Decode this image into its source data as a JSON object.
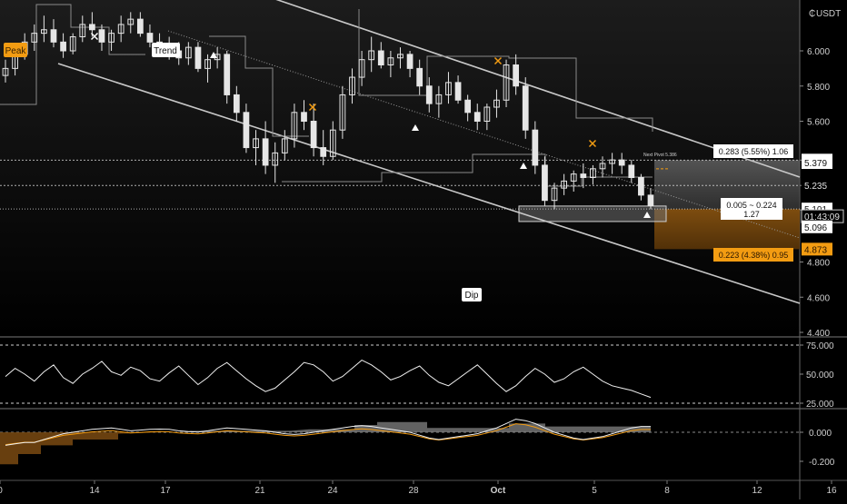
{
  "currency_label": "USDT",
  "main_axis": {
    "ticks": [
      "6.000",
      "5.800",
      "5.600",
      "5.379",
      "5.235",
      "5.096",
      "4.800",
      "4.600",
      "4.400"
    ],
    "tick_values": [
      6.0,
      5.8,
      5.6,
      5.379,
      5.235,
      5.096,
      4.8,
      4.6,
      4.4
    ]
  },
  "price_tags": [
    {
      "text": "5.379",
      "value": 5.379,
      "style": "light"
    },
    {
      "text": "5.379",
      "value": 5.365,
      "style": "light"
    },
    {
      "text": "5.235",
      "value": 5.235,
      "style": "dark"
    },
    {
      "text": "5.101",
      "value": 5.101,
      "style": "light"
    },
    {
      "text": "01:43:09",
      "value": 5.06,
      "style": "outline"
    },
    {
      "text": "5.096",
      "value": 5.0,
      "style": "light"
    },
    {
      "text": "4.873",
      "value": 4.873,
      "style": "orange"
    }
  ],
  "date_axis": {
    "labels": [
      "0",
      "14",
      "17",
      "21",
      "24",
      "28",
      "Oct",
      "5",
      "8",
      "12",
      "16"
    ],
    "label_day_index": [
      10,
      14,
      17,
      21,
      24,
      28,
      31,
      35,
      38,
      42,
      46
    ]
  },
  "annotations": {
    "peak": "Peak",
    "trend": "Trend",
    "dip": "Dip",
    "next_pivot": "Next Pivot 5.386",
    "target_up": "0.283 (5.55%) 1.06",
    "mid_line1": "0.005 ~ 0.224",
    "mid_line2": "1.27",
    "target_down": "0.223 (4.38%) 0.95"
  },
  "rsi_axis": {
    "ticks": [
      "75.000",
      "50.000",
      "25.000"
    ],
    "tick_values": [
      75,
      50,
      25
    ]
  },
  "osc_axis": {
    "ticks": [
      "0.000",
      "-0.200"
    ],
    "tick_values": [
      0,
      -0.2
    ]
  },
  "colors": {
    "background": "#000000",
    "candle": "#e6e6e6",
    "accent_orange": "#f39c12",
    "orange_fill": "#7a4a12",
    "grey_zone": "#5a5a5a",
    "axis_text": "#cfcfcf"
  },
  "chart_data": [
    {
      "type": "candlestick",
      "title": "",
      "x_unit": "trading period (Sep–Oct)",
      "ylim": [
        4.4,
        6.25
      ],
      "ohlc_rough": [
        [
          5.86,
          5.95,
          5.82,
          5.9
        ],
        [
          5.9,
          6.02,
          5.86,
          5.98
        ],
        [
          5.98,
          6.1,
          5.95,
          6.05
        ],
        [
          6.05,
          6.15,
          6.0,
          6.1
        ],
        [
          6.1,
          6.2,
          6.05,
          6.12
        ],
        [
          6.12,
          6.18,
          6.02,
          6.05
        ],
        [
          6.05,
          6.1,
          5.96,
          6.0
        ],
        [
          6.0,
          6.1,
          5.98,
          6.08
        ],
        [
          6.08,
          6.2,
          6.05,
          6.15
        ],
        [
          6.15,
          6.22,
          6.08,
          6.12
        ],
        [
          6.12,
          6.15,
          6.0,
          6.05
        ],
        [
          6.05,
          6.12,
          6.0,
          6.1
        ],
        [
          6.1,
          6.2,
          6.05,
          6.15
        ],
        [
          6.15,
          6.22,
          6.1,
          6.18
        ],
        [
          6.18,
          6.22,
          6.08,
          6.1
        ],
        [
          6.1,
          6.15,
          6.02,
          6.05
        ],
        [
          6.05,
          6.1,
          5.98,
          6.02
        ],
        [
          6.02,
          6.08,
          5.95,
          6.0
        ],
        [
          6.0,
          6.05,
          5.92,
          5.96
        ],
        [
          5.96,
          6.05,
          5.92,
          6.02
        ],
        [
          6.02,
          6.05,
          5.88,
          5.9
        ],
        [
          5.9,
          5.98,
          5.82,
          5.95
        ],
        [
          5.95,
          6.02,
          5.9,
          5.98
        ],
        [
          5.98,
          6.0,
          5.7,
          5.75
        ],
        [
          5.75,
          5.8,
          5.6,
          5.65
        ],
        [
          5.65,
          5.7,
          5.42,
          5.45
        ],
        [
          5.45,
          5.55,
          5.35,
          5.5
        ],
        [
          5.5,
          5.6,
          5.3,
          5.35
        ],
        [
          5.35,
          5.48,
          5.25,
          5.42
        ],
        [
          5.42,
          5.55,
          5.38,
          5.5
        ],
        [
          5.5,
          5.7,
          5.45,
          5.65
        ],
        [
          5.65,
          5.72,
          5.55,
          5.6
        ],
        [
          5.6,
          5.7,
          5.4,
          5.45
        ],
        [
          5.45,
          5.55,
          5.35,
          5.4
        ],
        [
          5.4,
          5.6,
          5.38,
          5.55
        ],
        [
          5.55,
          5.8,
          5.5,
          5.75
        ],
        [
          5.75,
          5.9,
          5.7,
          5.85
        ],
        [
          5.85,
          6.0,
          5.8,
          5.95
        ],
        [
          5.95,
          6.08,
          5.88,
          6.0
        ],
        [
          6.0,
          6.05,
          5.9,
          5.92
        ],
        [
          5.92,
          6.0,
          5.85,
          5.96
        ],
        [
          5.96,
          6.02,
          5.9,
          5.98
        ],
        [
          5.98,
          6.0,
          5.85,
          5.9
        ],
        [
          5.9,
          5.95,
          5.75,
          5.8
        ],
        [
          5.8,
          5.85,
          5.65,
          5.7
        ],
        [
          5.7,
          5.8,
          5.62,
          5.75
        ],
        [
          5.75,
          5.88,
          5.7,
          5.82
        ],
        [
          5.82,
          5.86,
          5.7,
          5.72
        ],
        [
          5.72,
          5.75,
          5.6,
          5.65
        ],
        [
          5.65,
          5.7,
          5.55,
          5.6
        ],
        [
          5.6,
          5.7,
          5.55,
          5.68
        ],
        [
          5.68,
          5.78,
          5.62,
          5.72
        ],
        [
          5.72,
          5.95,
          5.68,
          5.92
        ],
        [
          5.92,
          5.98,
          5.75,
          5.8
        ],
        [
          5.8,
          5.85,
          5.5,
          5.55
        ],
        [
          5.55,
          5.6,
          5.3,
          5.35
        ],
        [
          5.35,
          5.4,
          5.12,
          5.15
        ],
        [
          5.15,
          5.25,
          5.1,
          5.22
        ],
        [
          5.22,
          5.3,
          5.18,
          5.26
        ],
        [
          5.26,
          5.32,
          5.2,
          5.3
        ],
        [
          5.3,
          5.36,
          5.22,
          5.28
        ],
        [
          5.28,
          5.35,
          5.24,
          5.33
        ],
        [
          5.33,
          5.4,
          5.28,
          5.36
        ],
        [
          5.36,
          5.42,
          5.3,
          5.38
        ],
        [
          5.38,
          5.42,
          5.3,
          5.35
        ],
        [
          5.35,
          5.38,
          5.25,
          5.28
        ],
        [
          5.28,
          5.3,
          5.15,
          5.18
        ],
        [
          5.18,
          5.22,
          5.1,
          5.12
        ]
      ],
      "channel_upper": [
        [
          6.25,
          0
        ],
        [
          5.35,
          1
        ]
      ],
      "channel_lower": [
        [
          5.88,
          0
        ],
        [
          4.62,
          1
        ]
      ],
      "horizontal_levels": [
        5.379,
        5.235,
        5.101
      ]
    },
    {
      "type": "line",
      "title": "",
      "ylim": [
        15,
        85
      ],
      "series": [
        {
          "values": [
            48,
            55,
            50,
            44,
            52,
            58,
            47,
            42,
            50,
            55,
            61,
            52,
            49,
            56,
            53,
            46,
            44,
            51,
            57,
            49,
            41,
            47,
            55,
            60,
            53,
            46,
            40,
            35,
            38,
            45,
            52,
            60,
            58,
            52,
            44,
            48,
            55,
            62,
            58,
            52,
            45,
            48,
            53,
            57,
            49,
            43,
            40,
            46,
            52,
            58,
            50,
            42,
            35,
            40,
            48,
            55,
            50,
            43,
            46,
            52,
            56,
            50,
            44,
            40,
            38,
            36,
            33,
            30
          ]
        }
      ],
      "reference_lines": [
        75,
        25
      ]
    },
    {
      "type": "area",
      "title": "",
      "ylim": [
        -0.32,
        0.12
      ],
      "series": [
        {
          "values": [
            -0.1,
            -0.09,
            -0.08,
            -0.08,
            -0.06,
            -0.04,
            -0.02,
            -0.01,
            0.0,
            0.01,
            0.015,
            0.02,
            0.01,
            0.0,
            0.005,
            0.01,
            0.012,
            0.01,
            0.0,
            -0.005,
            -0.008,
            0.0,
            0.01,
            0.02,
            0.015,
            0.01,
            0.005,
            0.0,
            -0.01,
            -0.02,
            -0.025,
            -0.02,
            -0.01,
            0.0,
            0.01,
            0.02,
            0.03,
            0.035,
            0.03,
            0.02,
            0.01,
            0.0,
            -0.01,
            -0.03,
            -0.05,
            -0.06,
            -0.05,
            -0.04,
            -0.03,
            -0.02,
            0.0,
            0.02,
            0.05,
            0.08,
            0.07,
            0.05,
            0.02,
            -0.01,
            -0.03,
            -0.05,
            -0.06,
            -0.05,
            -0.04,
            -0.02,
            0.0,
            0.02,
            0.03,
            0.03
          ]
        }
      ],
      "reference_lines": [
        0
      ]
    }
  ]
}
